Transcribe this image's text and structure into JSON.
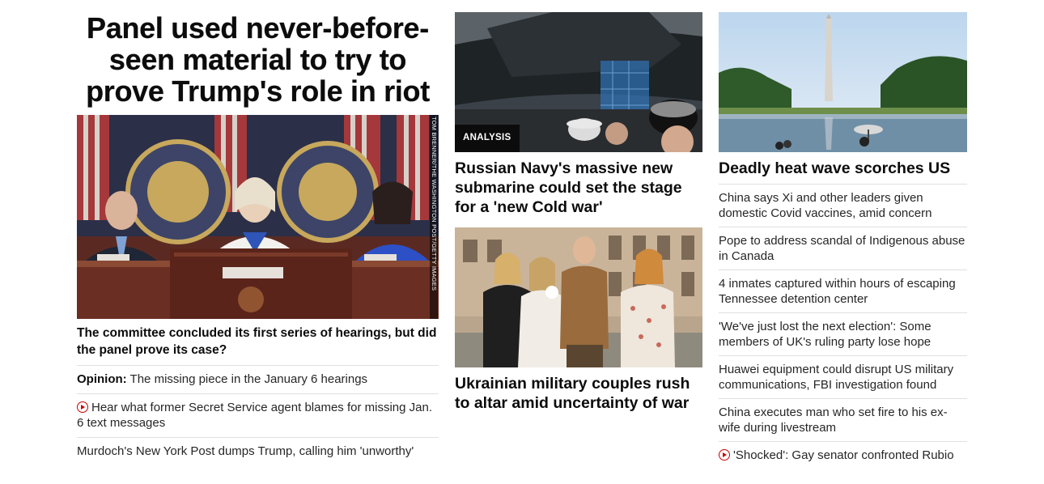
{
  "column1": {
    "banner_headline": "Panel used never-before-seen material to try to prove Trump's role in riot",
    "image_credit": "TOM BRENNER/THE WASHINGTON POST/GETTY IMAGES",
    "lead_headline": "The committee concluded its first series of hearings, but did the panel prove its case?",
    "items": [
      {
        "prefix": "Opinion:",
        "text": " The missing piece in the January 6 hearings",
        "video": false
      },
      {
        "prefix": "",
        "text": "Hear what former Secret Service agent blames for missing Jan. 6 text messages",
        "video": true
      },
      {
        "prefix": "",
        "text": "Murdoch's New York Post dumps Trump, calling him 'unworthy'",
        "video": false
      }
    ]
  },
  "column2": {
    "stories": [
      {
        "badge": "ANALYSIS",
        "headline": "Russian Navy's massive new submarine could set the stage for a 'new Cold war'"
      },
      {
        "badge": "",
        "headline": "Ukrainian military couples rush to altar amid uncertainty of war"
      }
    ]
  },
  "column3": {
    "lead_headline": "Deadly heat wave scorches US",
    "items": [
      {
        "text": "China says Xi and other leaders given domestic Covid vaccines, amid concern",
        "video": false
      },
      {
        "text": "Pope to address scandal of Indigenous abuse in Canada",
        "video": false
      },
      {
        "text": "4 inmates captured within hours of escaping Tennessee detention center",
        "video": false
      },
      {
        "text": "'We've just lost the next election': Some members of UK's ruling party lose hope",
        "video": false
      },
      {
        "text": "Huawei equipment could disrupt US military communications, FBI investigation found",
        "video": false
      },
      {
        "text": "China executes man who set fire to his ex-wife during livestream",
        "video": false
      },
      {
        "text": "'Shocked': Gay senator confronted Rubio",
        "video": true
      }
    ]
  },
  "colors": {
    "text": "#262626",
    "headline": "#0c0c0c",
    "divider": "#e0e0e0",
    "video_red": "#cc0000",
    "badge_bg": "#0c0c0c"
  },
  "icons": {
    "video": "play-circle-icon"
  }
}
